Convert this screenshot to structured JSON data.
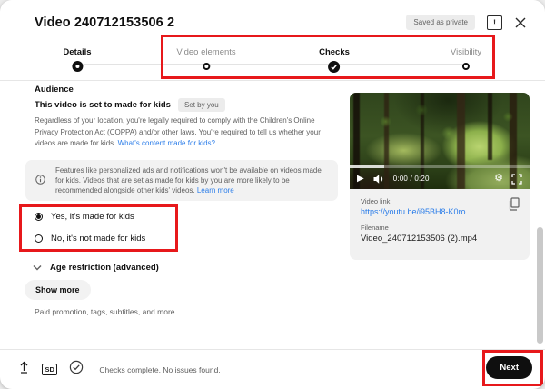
{
  "header": {
    "title": "Video 240712153506 2",
    "saved_badge": "Saved as private"
  },
  "stepper": {
    "steps": [
      {
        "label": "Details",
        "state": "active"
      },
      {
        "label": "Video elements",
        "state": "upcoming"
      },
      {
        "label": "Checks",
        "state": "complete"
      },
      {
        "label": "Visibility",
        "state": "upcoming"
      }
    ]
  },
  "audience": {
    "section_title": "Audience",
    "status_line": "This video is set to made for kids",
    "status_badge": "Set by you",
    "coppa_text": "Regardless of your location, you're legally required to comply with the Children's Online Privacy Protection Act (COPPA) and/or other laws. You're required to tell us whether your videos are made for kids. ",
    "coppa_link": "What's content made for kids?",
    "info_text": "Features like personalized ads and notifications won't be available on videos made for kids. Videos that are set as made for kids by you are more likely to be recommended alongside other kids' videos. ",
    "info_link": "Learn more",
    "options": [
      {
        "label": "Yes, it's made for kids",
        "selected": true
      },
      {
        "label": "No, it's not made for kids",
        "selected": false
      }
    ],
    "age_restriction_label": "Age restriction (advanced)",
    "show_more_label": "Show more",
    "show_more_hint": "Paid promotion, tags, subtitles, and more"
  },
  "player": {
    "time": "0:00 / 0:20"
  },
  "video_info": {
    "link_label": "Video link",
    "link_url": "https://youtu.be/i95BH8-K0ro",
    "filename_label": "Filename",
    "filename": "Video_240712153506 (2).mp4"
  },
  "footer": {
    "sd_badge": "SD",
    "status": "Checks complete. No issues found.",
    "next_label": "Next"
  },
  "icons": {
    "play": "▶",
    "gear": "⚙"
  },
  "colors": {
    "annotation_red": "#e7181b",
    "link_blue": "#2b7de9",
    "text_gray": "#606060",
    "accent_black": "#0f0f0f"
  }
}
